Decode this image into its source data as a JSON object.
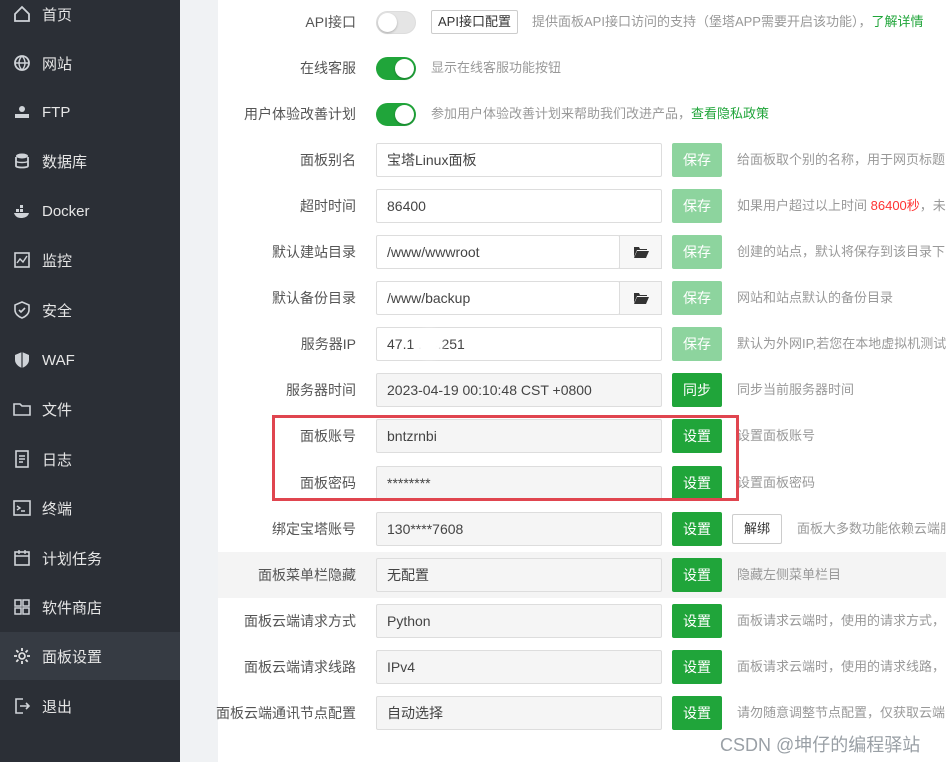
{
  "sidebar": {
    "items": [
      {
        "label": "首页",
        "icon": "home-icon"
      },
      {
        "label": "网站",
        "icon": "globe-icon"
      },
      {
        "label": "FTP",
        "icon": "ftp-icon"
      },
      {
        "label": "数据库",
        "icon": "database-icon"
      },
      {
        "label": "Docker",
        "icon": "docker-icon"
      },
      {
        "label": "监控",
        "icon": "monitor-icon"
      },
      {
        "label": "安全",
        "icon": "shield-icon"
      },
      {
        "label": "WAF",
        "icon": "waf-shield-icon"
      },
      {
        "label": "文件",
        "icon": "folder-icon"
      },
      {
        "label": "日志",
        "icon": "log-icon"
      },
      {
        "label": "终端",
        "icon": "terminal-icon"
      },
      {
        "label": "计划任务",
        "icon": "calendar-icon"
      },
      {
        "label": "软件商店",
        "icon": "apps-grid-icon"
      },
      {
        "label": "面板设置",
        "icon": "gear-icon"
      },
      {
        "label": "退出",
        "icon": "logout-icon"
      }
    ],
    "active_index": 13
  },
  "settings": {
    "api": {
      "label": "API接口",
      "enabled": false,
      "button": "API接口配置",
      "hint": "提供面板API接口访问的支持（堡塔APP需要开启该功能），",
      "link": "了解详情"
    },
    "online_service": {
      "label": "在线客服",
      "enabled": true,
      "hint": "显示在线客服功能按钮"
    },
    "ux_plan": {
      "label": "用户体验改善计划",
      "enabled": true,
      "hint": "参加用户体验改善计划来帮助我们改进产品，",
      "link": "查看隐私政策"
    },
    "panel_alias": {
      "label": "面板别名",
      "value": "宝塔Linux面板",
      "button": "保存",
      "hint": "给面板取个别的名称，用于网页标题"
    },
    "timeout": {
      "label": "超时时间",
      "value": "86400",
      "button": "保存",
      "hint_prefix": "如果用户超过以上时间 ",
      "hint_red": "86400秒",
      "hint_suffix": "，未"
    },
    "site_dir": {
      "label": "默认建站目录",
      "value": "/www/wwwroot",
      "button": "保存",
      "hint": "创建的站点，默认将保存到该目录下"
    },
    "backup_dir": {
      "label": "默认备份目录",
      "value": "/www/backup",
      "button": "保存",
      "hint": "网站和站点默认的备份目录"
    },
    "server_ip": {
      "label": "服务器IP",
      "value": "47.1    .64.251",
      "button": "保存",
      "hint": "默认为外网IP,若您在本地虚拟机测试"
    },
    "server_time": {
      "label": "服务器时间",
      "value": "2023-04-19 00:10:48 CST +0800",
      "button": "同步",
      "hint": "同步当前服务器时间"
    },
    "panel_account": {
      "label": "面板账号",
      "value": "bntzrnbi",
      "button": "设置",
      "hint": "设置面板账号"
    },
    "panel_password": {
      "label": "面板密码",
      "value": "********",
      "button": "设置",
      "hint": "设置面板密码"
    },
    "bt_account": {
      "label": "绑定宝塔账号",
      "value": "130****7608",
      "button": "设置",
      "unbind": "解绑",
      "hint": "面板大多数功能依赖云端服"
    },
    "menu_hide": {
      "label": "面板菜单栏隐藏",
      "value": "无配置",
      "button": "设置",
      "hint": "隐藏左侧菜单栏目"
    },
    "cloud_method": {
      "label": "面板云端请求方式",
      "value": "Python",
      "button": "设置",
      "hint": "面板请求云端时，使用的请求方式，"
    },
    "cloud_line": {
      "label": "面板云端请求线路",
      "value": "IPv4",
      "button": "设置",
      "hint": "面板请求云端时，使用的请求线路，"
    },
    "cloud_node": {
      "label": "面板云端通讯节点配置",
      "value": "自动选择",
      "button": "设置",
      "hint": "请勿随意调整节点配置，仅获取云端"
    }
  },
  "watermark": "CSDN @坤仔的编程驿站",
  "colors": {
    "sidebar_bg": "#2b2f36",
    "accent_green": "#20a53a",
    "highlight_red": "#e0454f"
  }
}
